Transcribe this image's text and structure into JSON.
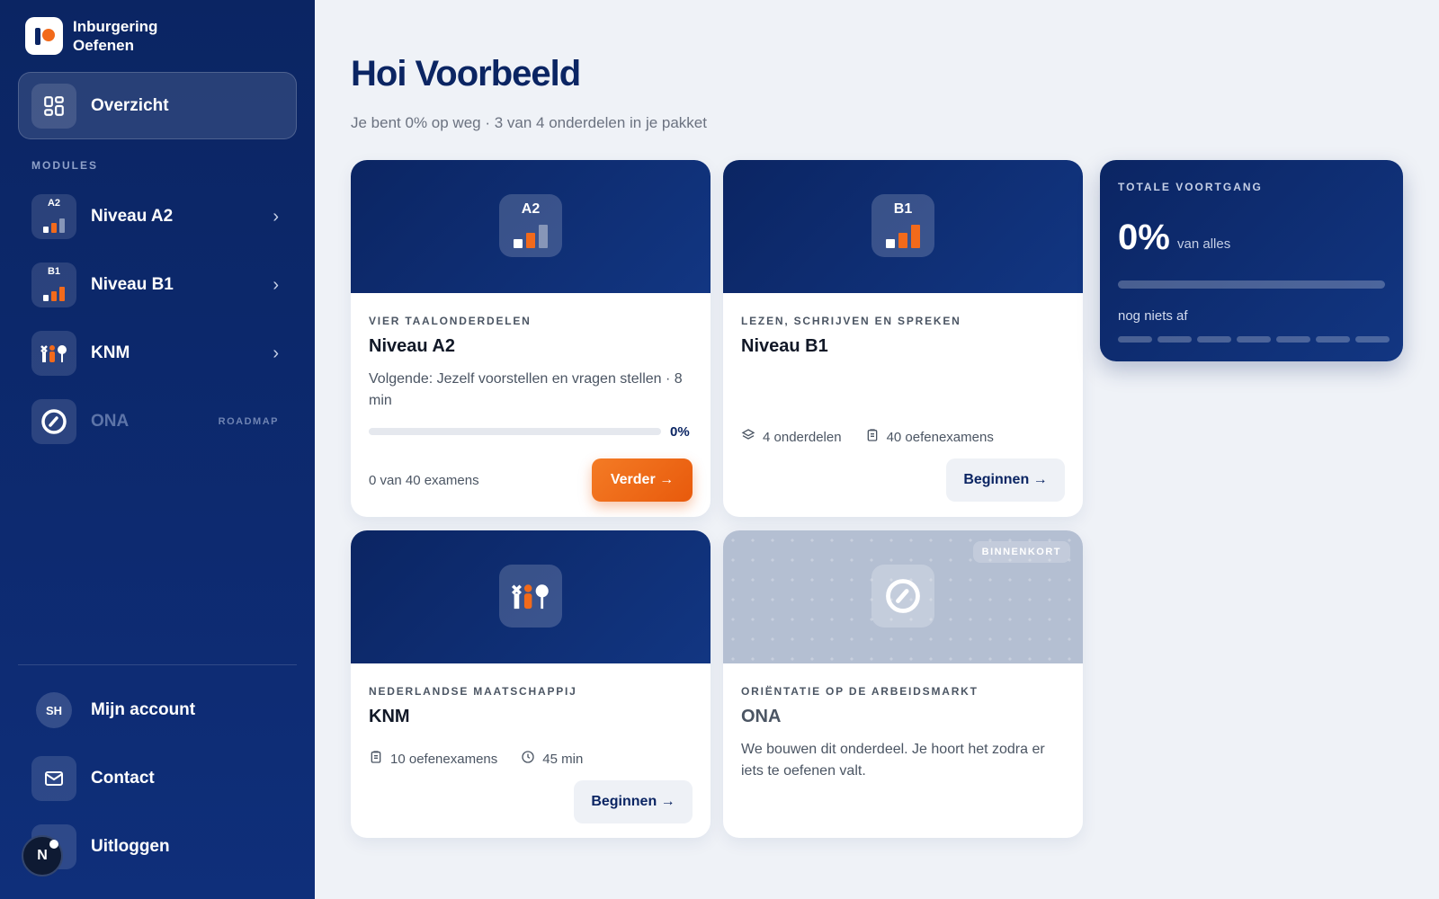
{
  "brand": {
    "line1": "Inburgering",
    "line2": "Oefenen"
  },
  "sidebar": {
    "active": "Overzicht",
    "section": "MODULES",
    "items": [
      {
        "label": "Niveau A2",
        "badge": "A2"
      },
      {
        "label": "Niveau B1",
        "badge": "B1"
      },
      {
        "label": "KNM"
      },
      {
        "label": "ONA",
        "tag": "ROADMAP"
      }
    ],
    "bottom": [
      {
        "label": "Mijn account",
        "avatar": "SH"
      },
      {
        "label": "Contact"
      },
      {
        "label": "Uitloggen"
      }
    ],
    "badge": "N"
  },
  "header": {
    "title": "Hoi Voorbeeld",
    "subtitle": "Je bent 0% op weg · 3 van 4 onderdelen in je pakket"
  },
  "cards": {
    "a2": {
      "icon_label": "A2",
      "eyebrow": "VIER TAALONDERDELEN",
      "title": "Niveau A2",
      "desc": "Volgende: Jezelf voorstellen en vragen stellen · 8 min",
      "progress_pct": "0%",
      "progress": 0,
      "exams": "0 van 40 examens",
      "button": "Verder"
    },
    "b1": {
      "icon_label": "B1",
      "eyebrow": "LEZEN, SCHRIJVEN EN SPREKEN",
      "title": "Niveau B1",
      "parts": "4 onderdelen",
      "exams": "40 oefenexamens",
      "button": "Beginnen"
    },
    "knm": {
      "eyebrow": "NEDERLANDSE MAATSCHAPPIJ",
      "title": "KNM",
      "exams": "10 oefenexamens",
      "time": "45 min",
      "button": "Beginnen"
    },
    "ona": {
      "badge": "BINNENKORT",
      "eyebrow": "ORIËNTATIE OP DE ARBEIDSMARKT",
      "title": "ONA",
      "desc": "We bouwen dit onderdeel. Je hoort het zodra er iets te oefenen valt."
    }
  },
  "total": {
    "eyebrow": "TOTALE VOORTGANG",
    "value": "0%",
    "of": "van alles",
    "progress": 0,
    "status": "nog niets af"
  },
  "colors": {
    "navy": "#0b2563",
    "orange": "#f26a1b",
    "page_bg": "#eff2f7"
  }
}
